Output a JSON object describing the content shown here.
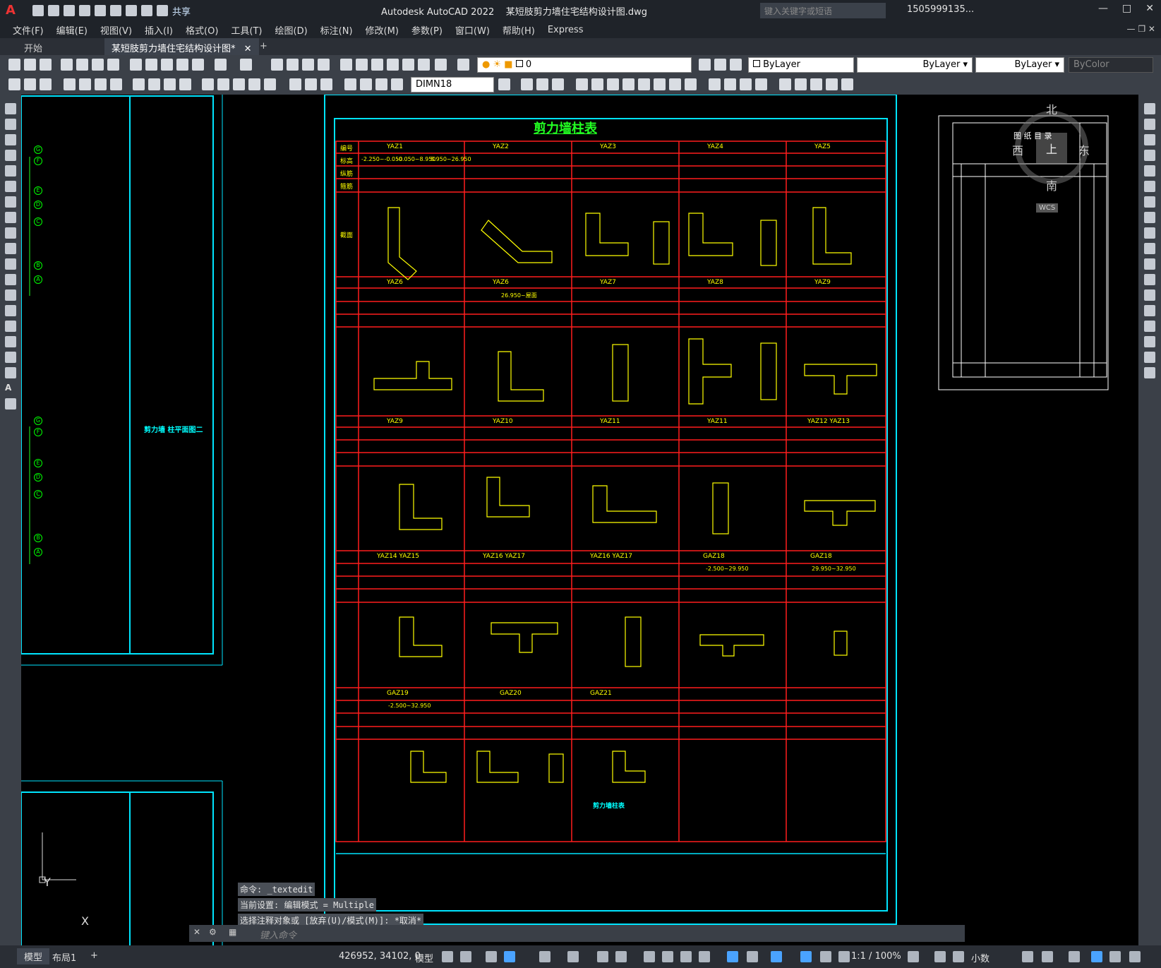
{
  "app": {
    "title": "Autodesk AutoCAD 2022",
    "file": "某短肢剪力墙住宅结构设计图.dwg",
    "share": "共享",
    "search_placeholder": "键入关键字或短语",
    "user": "1505999135...",
    "logo": "A"
  },
  "menu": [
    "文件(F)",
    "编辑(E)",
    "视图(V)",
    "插入(I)",
    "格式(O)",
    "工具(T)",
    "绘图(D)",
    "标注(N)",
    "修改(M)",
    "参数(P)",
    "窗口(W)",
    "帮助(H)",
    "Express"
  ],
  "tabs": {
    "start": "开始",
    "doc": "某短肢剪力墙住宅结构设计图*"
  },
  "toolbar": {
    "layer": "0",
    "color": "ByLayer",
    "linetype": "ByLayer",
    "lineweight": "ByLayer",
    "plotstyle": "ByColor",
    "dimstyle": "DIMN18"
  },
  "drawing": {
    "table_title": "剪力墙柱表",
    "table_caption": "剪力墙柱表",
    "plan_label": "剪力墙 柱平面图二",
    "grid_labels_top": [
      "G",
      "F",
      "E",
      "D",
      "C",
      "B",
      "A"
    ],
    "grid_labels_mid": [
      "G",
      "F",
      "E",
      "D",
      "C",
      "B",
      "A"
    ],
    "row_labels": [
      "编号",
      "标高",
      "纵筋",
      "箍筋",
      "截面"
    ],
    "groups": [
      [
        "YAZ1",
        "YAZ2",
        "YAZ3",
        "YAZ4",
        "YAZ5"
      ],
      [
        "YAZ6",
        "YAZ6",
        "YAZ7",
        "YAZ8",
        "YAZ9"
      ],
      [
        "YAZ9",
        "YAZ10",
        "YAZ11",
        "YAZ11",
        "YAZ12  YAZ13"
      ],
      [
        "YAZ14  YAZ15",
        "YAZ16  YAZ17",
        "YAZ16  YAZ17",
        "GAZ18",
        "GAZ18"
      ],
      [
        "GAZ19",
        "GAZ20",
        "GAZ21",
        "",
        ""
      ]
    ],
    "elevations": [
      "-2.250~-0.050",
      "-0.050~8.950",
      "8.950~26.950",
      "26.950~屋面",
      "-2.500~29.950",
      "29.950~32.950",
      "-2.500~32.950"
    ],
    "compass": {
      "n": "北",
      "s": "南",
      "e": "东",
      "w": "西",
      "top": "上",
      "wcs": "WCS"
    },
    "index_title": "图 纸 目 录"
  },
  "command": {
    "lines": [
      "命令: _textedit",
      "当前设置: 编辑模式 = Multiple",
      "选择注释对象或 [放弃(U)/模式(M)]: *取消*"
    ],
    "placeholder": "键入命令"
  },
  "status": {
    "model_tab": "模型",
    "layout_tab": "布局1",
    "coords": "426952, 34102, 0",
    "model": "模型",
    "scale": "1:1 / 100%",
    "units": "小数"
  },
  "ucs": {
    "x": "X",
    "y": "Y"
  },
  "colors": {
    "red": "#ff1e1e",
    "cyan": "#00e5ff",
    "yellow": "#ffff00",
    "green": "#22ff22"
  }
}
